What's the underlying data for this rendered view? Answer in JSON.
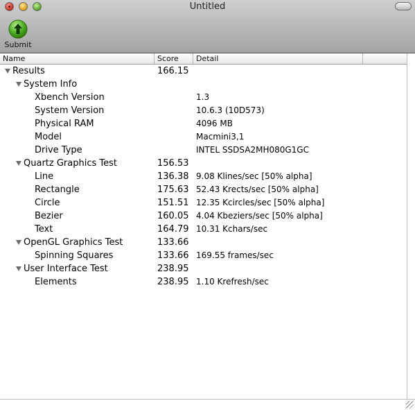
{
  "window": {
    "title": "Untitled"
  },
  "toolbar": {
    "submit_label": "Submit",
    "submit_icon": "up-arrow-icon",
    "accent": "#3c9a18"
  },
  "columns": {
    "name": "Name",
    "score": "Score",
    "detail": "Detail"
  },
  "rows": [
    {
      "level": 0,
      "expanded": true,
      "name": "Results",
      "score": "166.15",
      "detail": ""
    },
    {
      "level": 1,
      "expanded": true,
      "name": "System Info",
      "score": "",
      "detail": ""
    },
    {
      "level": 2,
      "name": "Xbench Version",
      "score": "",
      "detail": "1.3"
    },
    {
      "level": 2,
      "name": "System Version",
      "score": "",
      "detail": "10.6.3 (10D573)"
    },
    {
      "level": 2,
      "name": "Physical RAM",
      "score": "",
      "detail": "4096 MB"
    },
    {
      "level": 2,
      "name": "Model",
      "score": "",
      "detail": "Macmini3,1"
    },
    {
      "level": 2,
      "name": "Drive Type",
      "score": "",
      "detail": "INTEL SSDSA2MH080G1GC"
    },
    {
      "level": 1,
      "expanded": true,
      "name": "Quartz Graphics Test",
      "score": "156.53",
      "detail": ""
    },
    {
      "level": 2,
      "name": "Line",
      "score": "136.38",
      "detail": "9.08 Klines/sec [50% alpha]"
    },
    {
      "level": 2,
      "name": "Rectangle",
      "score": "175.63",
      "detail": "52.43 Krects/sec [50% alpha]"
    },
    {
      "level": 2,
      "name": "Circle",
      "score": "151.51",
      "detail": "12.35 Kcircles/sec [50% alpha]"
    },
    {
      "level": 2,
      "name": "Bezier",
      "score": "160.05",
      "detail": "4.04 Kbeziers/sec [50% alpha]"
    },
    {
      "level": 2,
      "name": "Text",
      "score": "164.79",
      "detail": "10.31 Kchars/sec"
    },
    {
      "level": 1,
      "expanded": true,
      "name": "OpenGL Graphics Test",
      "score": "133.66",
      "detail": ""
    },
    {
      "level": 2,
      "name": "Spinning Squares",
      "score": "133.66",
      "detail": "169.55 frames/sec"
    },
    {
      "level": 1,
      "expanded": true,
      "name": "User Interface Test",
      "score": "238.95",
      "detail": ""
    },
    {
      "level": 2,
      "name": "Elements",
      "score": "238.95",
      "detail": "1.10 Krefresh/sec"
    }
  ]
}
